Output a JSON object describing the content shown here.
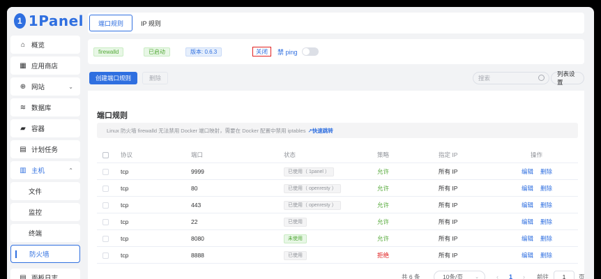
{
  "app": {
    "logo_mark": "1",
    "logo_text": "1Panel"
  },
  "sidebar": {
    "items": [
      {
        "label": "概览",
        "icon": "home-icon"
      },
      {
        "label": "应用商店",
        "icon": "grid-icon"
      },
      {
        "label": "网站",
        "icon": "globe-icon"
      },
      {
        "label": "数据库",
        "icon": "database-icon"
      },
      {
        "label": "容器",
        "icon": "docker-icon"
      },
      {
        "label": "计划任务",
        "icon": "calendar-icon"
      },
      {
        "label": "主机",
        "icon": "server-icon"
      },
      {
        "label": "文件"
      },
      {
        "label": "监控"
      },
      {
        "label": "终端"
      },
      {
        "label": "防火墙"
      },
      {
        "label": "面板日志",
        "icon": "log-icon"
      }
    ]
  },
  "tabs": [
    {
      "label": "端口规则"
    },
    {
      "label": "IP 规则"
    }
  ],
  "status": {
    "name": "firewalld",
    "state": "已启动",
    "version": "版本: 0.6.3",
    "close_button": "关闭",
    "ping_label": "禁 ping",
    "ping_disabled": false
  },
  "toolbar": {
    "create_label": "创建端口规则",
    "delete_label": "删除",
    "search_placeholder": "搜索",
    "columns_label": "列表设置"
  },
  "section": {
    "title": "端口规则",
    "notice": "Linux 防火墙 firewalld 无法禁用 Docker 端口映射，需要在 Docker 配置中禁用 iptables",
    "notice_link": "↗快速跳转"
  },
  "table": {
    "headers": {
      "protocol": "协议",
      "port": "端口",
      "status": "状态",
      "strategy": "策略",
      "ip": "指定 IP",
      "ops": "操作"
    },
    "rows": [
      {
        "protocol": "tcp",
        "port": "9999",
        "status": "已使用（ 1panel ）",
        "used": true,
        "strategy": "允许",
        "allow": true,
        "ip": "所有 IP",
        "edit": "编辑",
        "delete": "删除"
      },
      {
        "protocol": "tcp",
        "port": "80",
        "status": "已使用（ openresty ）",
        "used": true,
        "strategy": "允许",
        "allow": true,
        "ip": "所有 IP",
        "edit": "编辑",
        "delete": "删除"
      },
      {
        "protocol": "tcp",
        "port": "443",
        "status": "已使用（ openresty ）",
        "used": true,
        "strategy": "允许",
        "allow": true,
        "ip": "所有 IP",
        "edit": "编辑",
        "delete": "删除"
      },
      {
        "protocol": "tcp",
        "port": "22",
        "status": "已使用",
        "used": true,
        "strategy": "允许",
        "allow": true,
        "ip": "所有 IP",
        "edit": "编辑",
        "delete": "删除"
      },
      {
        "protocol": "tcp",
        "port": "8080",
        "status": "未使用",
        "used": false,
        "strategy": "允许",
        "allow": true,
        "ip": "所有 IP",
        "edit": "编辑",
        "delete": "删除"
      },
      {
        "protocol": "tcp",
        "port": "8888",
        "status": "已使用",
        "used": true,
        "strategy": "拒绝",
        "allow": false,
        "ip": "所有 IP",
        "edit": "编辑",
        "delete": "删除"
      }
    ]
  },
  "pagination": {
    "total": "共 6 条",
    "page_size": "10条/页",
    "prev": "‹",
    "current_page": "1",
    "next": "›",
    "goto_label": "前往",
    "goto_value": "1",
    "goto_suffix": "页"
  },
  "colors": {
    "primary": "#2f6fe0",
    "success": "#52a836",
    "danger": "#e02020",
    "highlight_border": "#e02020"
  }
}
